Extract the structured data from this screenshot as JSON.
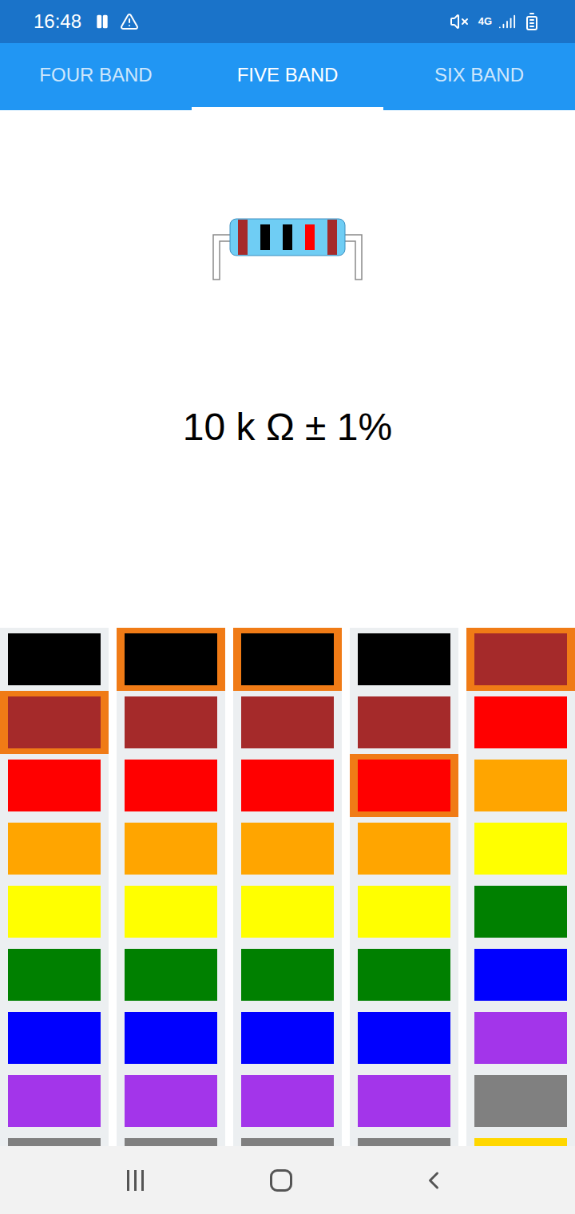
{
  "status_bar": {
    "time": "16:48",
    "network": "4G"
  },
  "tabs": [
    {
      "label": "FOUR BAND",
      "selected": false
    },
    {
      "label": "FIVE BAND",
      "selected": true
    },
    {
      "label": "SIX BAND",
      "selected": false
    }
  ],
  "resistor": {
    "bands": [
      "#a52a2a",
      "#000000",
      "#000000",
      "#ff0000",
      "#a52a2a"
    ]
  },
  "value": "10 k Ω ± 1%",
  "columns": [
    {
      "swatches": [
        {
          "color": "#000000",
          "selected": false
        },
        {
          "color": "#a52a2a",
          "selected": true
        },
        {
          "color": "#ff0000",
          "selected": false
        },
        {
          "color": "#ffa500",
          "selected": false
        },
        {
          "color": "#ffff00",
          "selected": false
        },
        {
          "color": "#008000",
          "selected": false
        },
        {
          "color": "#0000ff",
          "selected": false
        },
        {
          "color": "#a335ea",
          "selected": false
        },
        {
          "color": "#808080",
          "selected": false
        }
      ]
    },
    {
      "swatches": [
        {
          "color": "#000000",
          "selected": true
        },
        {
          "color": "#a52a2a",
          "selected": false
        },
        {
          "color": "#ff0000",
          "selected": false
        },
        {
          "color": "#ffa500",
          "selected": false
        },
        {
          "color": "#ffff00",
          "selected": false
        },
        {
          "color": "#008000",
          "selected": false
        },
        {
          "color": "#0000ff",
          "selected": false
        },
        {
          "color": "#a335ea",
          "selected": false
        },
        {
          "color": "#808080",
          "selected": false
        }
      ]
    },
    {
      "swatches": [
        {
          "color": "#000000",
          "selected": true
        },
        {
          "color": "#a52a2a",
          "selected": false
        },
        {
          "color": "#ff0000",
          "selected": false
        },
        {
          "color": "#ffa500",
          "selected": false
        },
        {
          "color": "#ffff00",
          "selected": false
        },
        {
          "color": "#008000",
          "selected": false
        },
        {
          "color": "#0000ff",
          "selected": false
        },
        {
          "color": "#a335ea",
          "selected": false
        },
        {
          "color": "#808080",
          "selected": false
        }
      ]
    },
    {
      "swatches": [
        {
          "color": "#000000",
          "selected": false
        },
        {
          "color": "#a52a2a",
          "selected": false
        },
        {
          "color": "#ff0000",
          "selected": true
        },
        {
          "color": "#ffa500",
          "selected": false
        },
        {
          "color": "#ffff00",
          "selected": false
        },
        {
          "color": "#008000",
          "selected": false
        },
        {
          "color": "#0000ff",
          "selected": false
        },
        {
          "color": "#a335ea",
          "selected": false
        },
        {
          "color": "#808080",
          "selected": false
        }
      ]
    },
    {
      "swatches": [
        {
          "color": "#a52a2a",
          "selected": true
        },
        {
          "color": "#ff0000",
          "selected": false
        },
        {
          "color": "#ffa500",
          "selected": false
        },
        {
          "color": "#ffff00",
          "selected": false
        },
        {
          "color": "#008000",
          "selected": false
        },
        {
          "color": "#0000ff",
          "selected": false
        },
        {
          "color": "#a335ea",
          "selected": false
        },
        {
          "color": "#808080",
          "selected": false
        },
        {
          "color": "#ffd700",
          "selected": false
        }
      ]
    }
  ]
}
